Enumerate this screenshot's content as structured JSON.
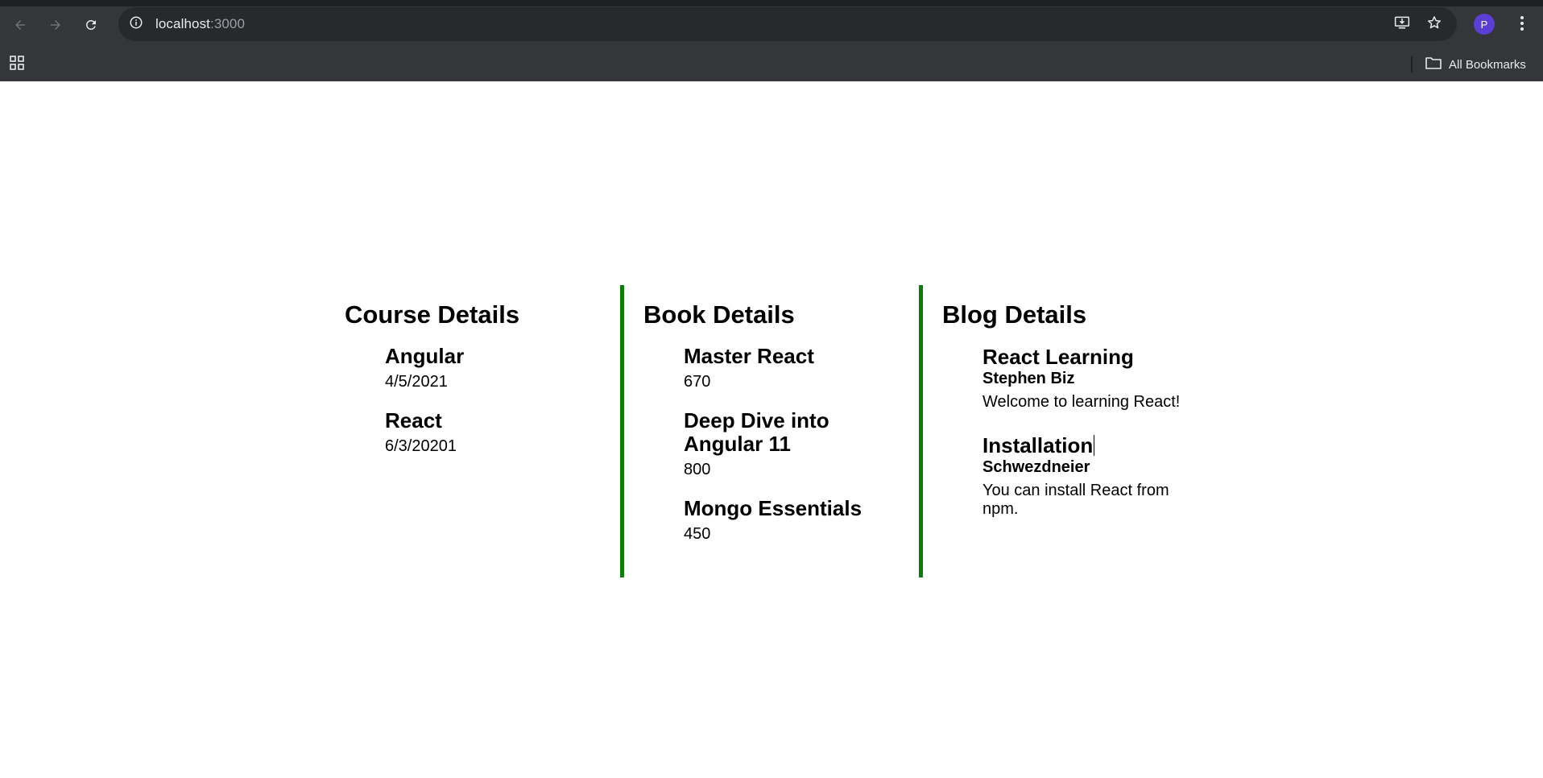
{
  "browser": {
    "url_host": "localhost",
    "url_port": ":3000",
    "profile_initial": "P",
    "bookmarks_label": "All Bookmarks",
    "icons": {
      "back": "back-arrow-icon",
      "forward": "forward-arrow-icon",
      "reload": "reload-icon",
      "site_info": "info-icon",
      "install": "install-app-icon",
      "bookmark": "star-icon",
      "menu": "kebab-menu-icon",
      "apps": "apps-grid-icon",
      "folder": "folder-icon"
    }
  },
  "page": {
    "accent_color": "#0a7d0a",
    "course": {
      "title": "Course Details",
      "items": [
        {
          "name": "Angular",
          "date": "4/5/2021"
        },
        {
          "name": "React",
          "date": "6/3/20201"
        }
      ]
    },
    "book": {
      "title": "Book Details",
      "items": [
        {
          "name": "Master React",
          "value": "670"
        },
        {
          "name": "Deep Dive into Angular 11",
          "value": "800"
        },
        {
          "name": "Mongo Essentials",
          "value": "450"
        }
      ]
    },
    "blog": {
      "title": "Blog Details",
      "items": [
        {
          "title": "React Learning",
          "author": "Stephen Biz",
          "body": "Welcome to learning React!"
        },
        {
          "title": "Installation",
          "author": "Schwezdneier",
          "body": "You can install React from npm."
        }
      ]
    }
  }
}
